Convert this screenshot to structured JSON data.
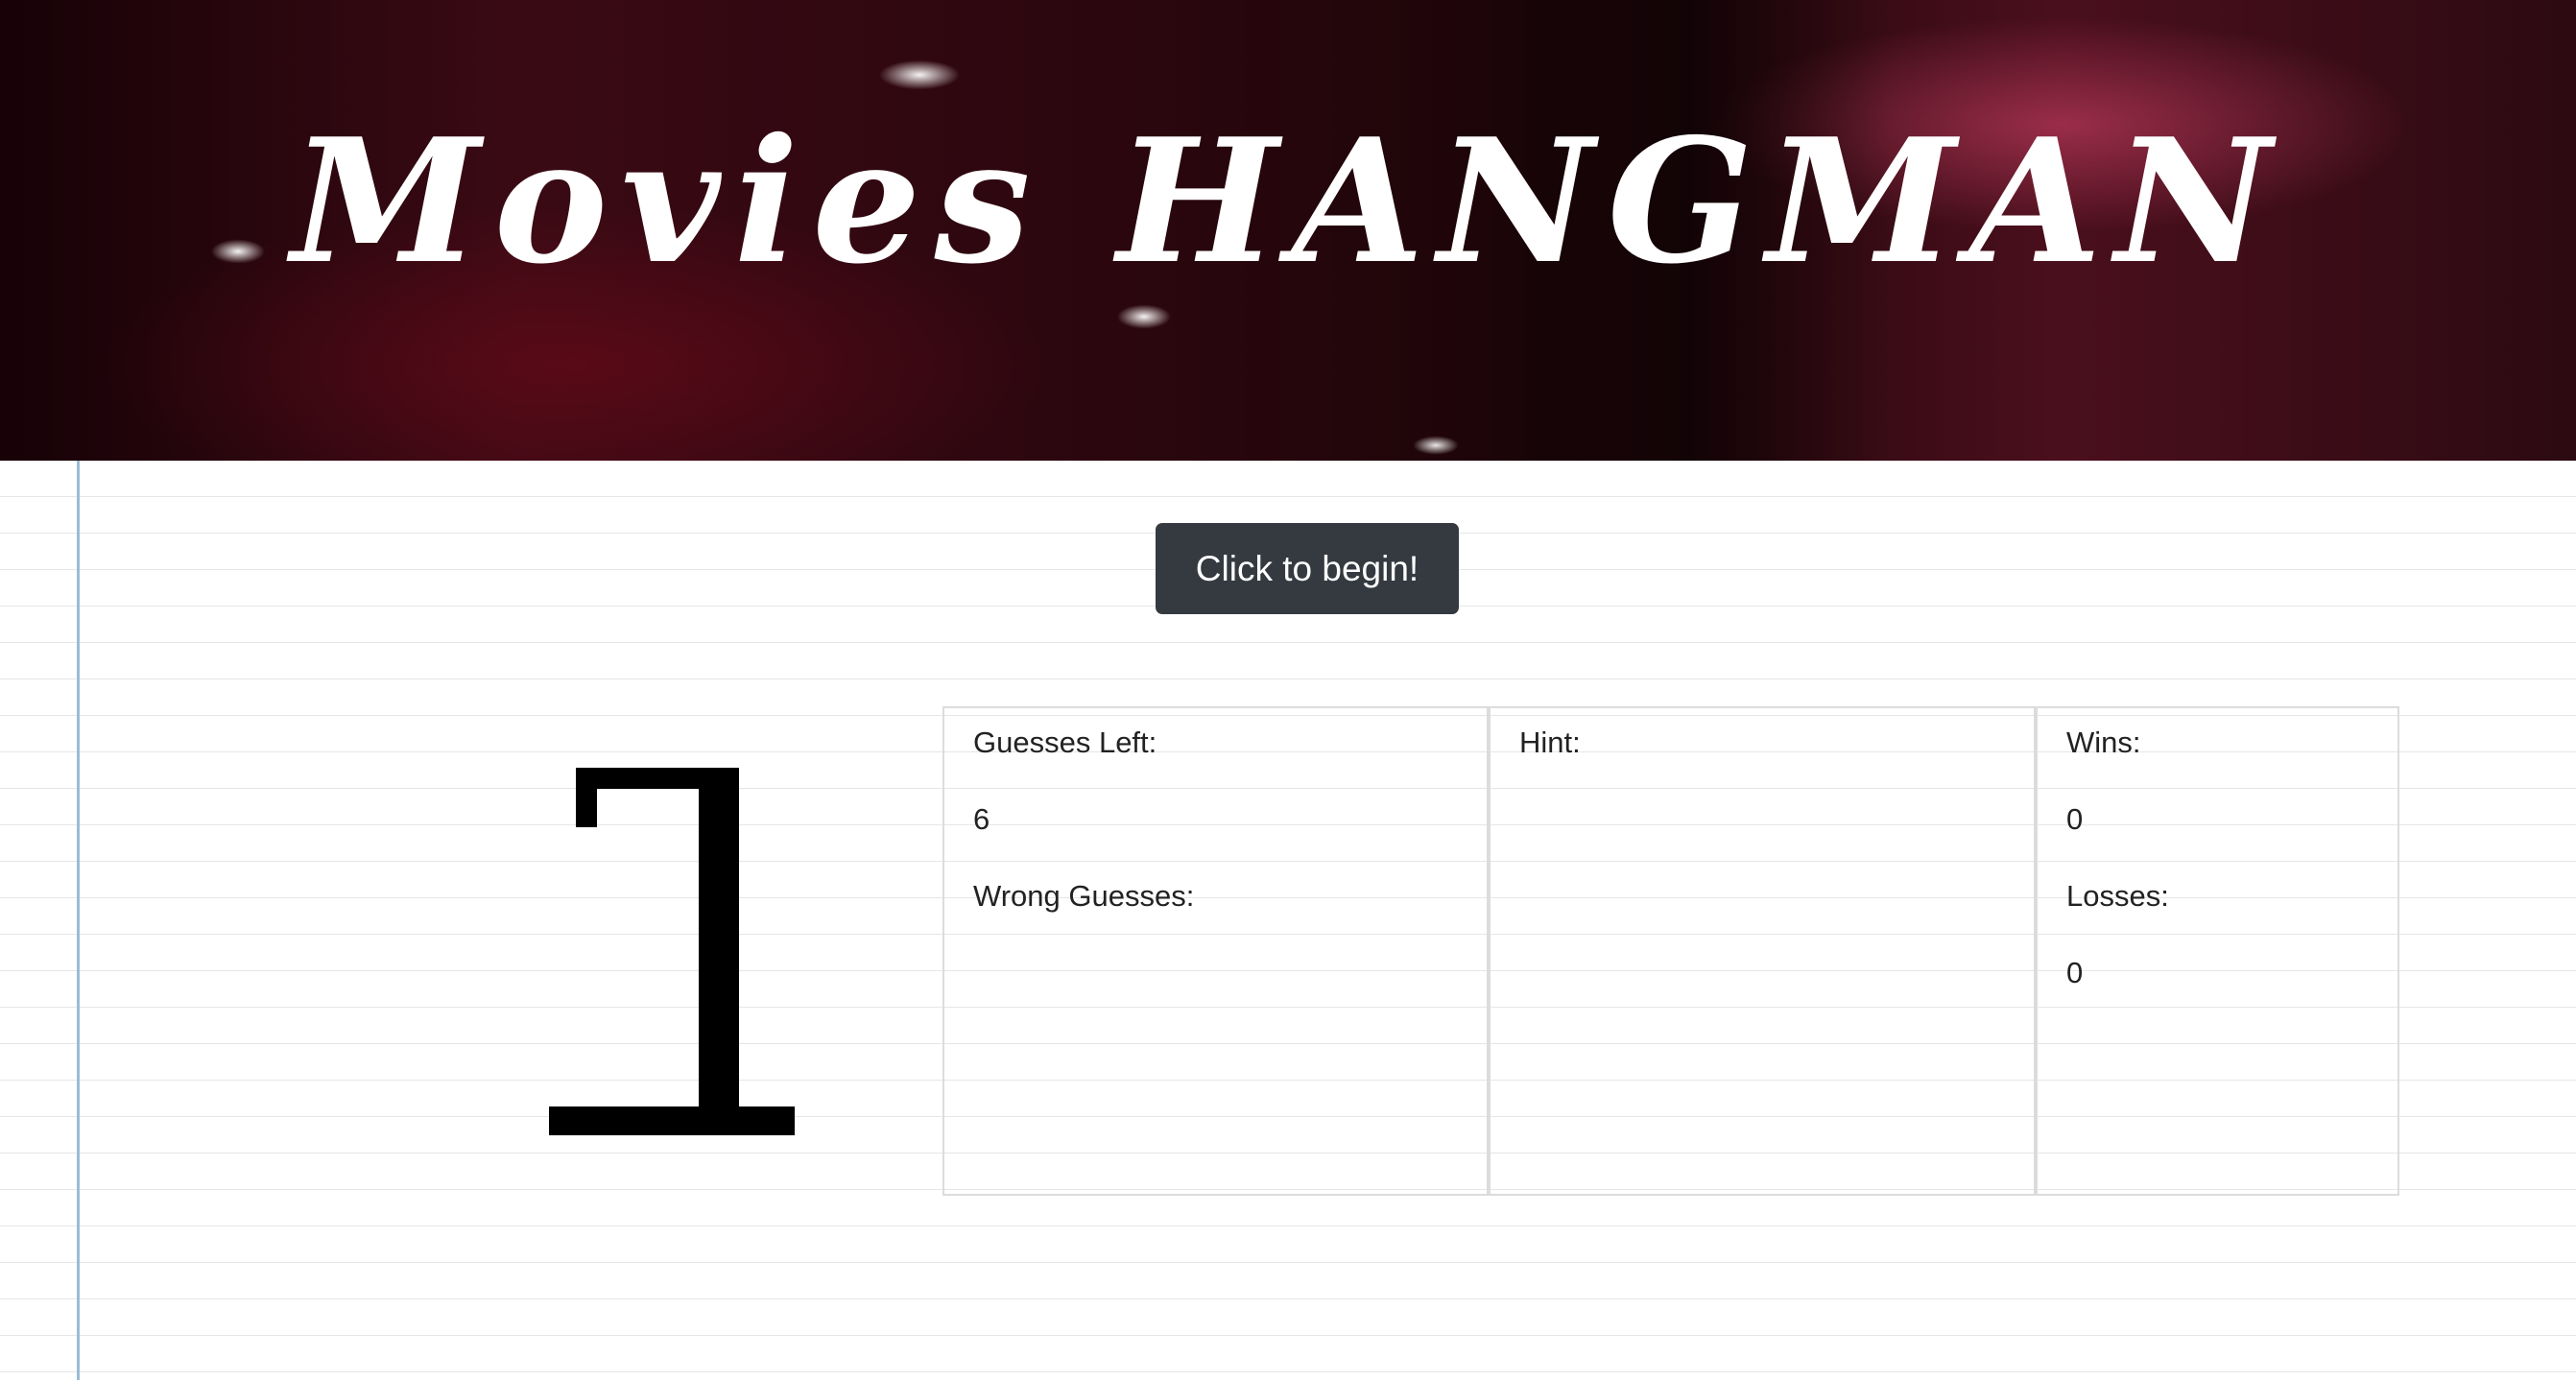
{
  "header": {
    "title": "Movies HANGMAN"
  },
  "controls": {
    "begin_label": "Click to begin!"
  },
  "stats": {
    "guesses_left_label": "Guesses Left:",
    "guesses_left_value": "6",
    "wrong_guesses_label": "Wrong Guesses:",
    "wrong_guesses_value": "",
    "hint_label": "Hint:",
    "hint_value": "",
    "wins_label": "Wins:",
    "wins_value": "0",
    "losses_label": "Losses:",
    "losses_value": "0"
  },
  "colors": {
    "button_bg": "#343a40",
    "margin_line": "#9cbcd6",
    "ruled_line": "#e6e6e6"
  }
}
